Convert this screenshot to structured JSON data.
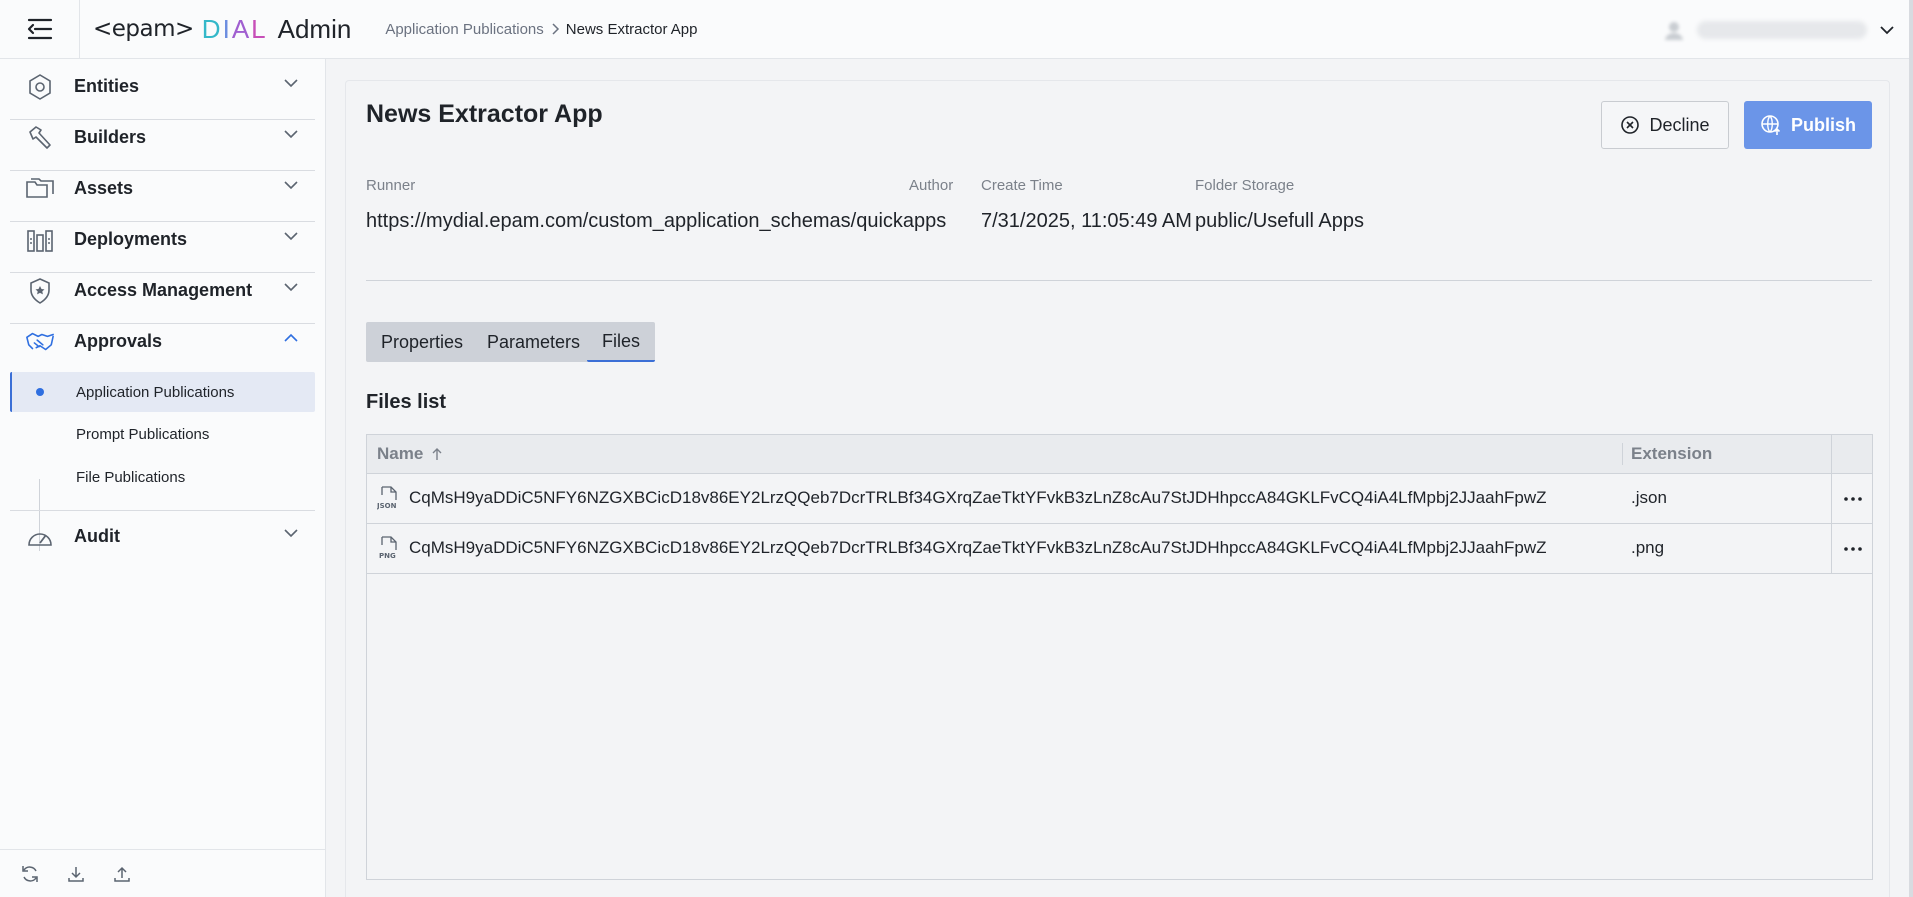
{
  "header": {
    "logo_epam": "<epam>",
    "logo_dial": [
      "D",
      "I",
      "A",
      "L"
    ],
    "logo_admin": "Admin",
    "breadcrumb": [
      "Application Publications",
      "News Extractor App"
    ]
  },
  "sidebar": {
    "items": [
      {
        "label": "Entities",
        "icon": "hexagon-icon"
      },
      {
        "label": "Builders",
        "icon": "hammer-icon"
      },
      {
        "label": "Assets",
        "icon": "folders-icon"
      },
      {
        "label": "Deployments",
        "icon": "deployments-icon"
      },
      {
        "label": "Access Management",
        "icon": "shield-star-icon"
      },
      {
        "label": "Approvals",
        "icon": "handshake-icon"
      },
      {
        "label": "Audit",
        "icon": "gauge-icon"
      }
    ],
    "approvals_sub": [
      "Application Publications",
      "Prompt Publications",
      "File Publications"
    ],
    "footer_icons": [
      "refresh-icon",
      "download-icon",
      "upload-icon"
    ]
  },
  "page": {
    "title": "News Extractor App",
    "decline_label": "Decline",
    "publish_label": "Publish",
    "meta": {
      "runner_label": "Runner",
      "runner_value": "https://mydial.epam.com/custom_application_schemas/quickapps",
      "author_label": "Author",
      "author_value": "",
      "create_time_label": "Create Time",
      "create_time_value": "7/31/2025, 11:05:49 AM",
      "folder_label": "Folder Storage",
      "folder_value": "public/Usefull Apps"
    },
    "tabs": [
      "Properties",
      "Parameters",
      "Files"
    ],
    "active_tab": "Files",
    "files_title": "Files list",
    "table": {
      "col_name": "Name",
      "col_ext": "Extension",
      "rows": [
        {
          "name": "CqMsH9yaDDiC5NFY6NZGXBCicD18v86EY2LrzQQeb7DcrTRLBf34GXrqZaeTktYFvkB3zLnZ8cAu7StJDHhpccA84GKLFvCQ4iA4LfMpbj2JJaahFpwZ",
          "ext": ".json",
          "icon_text": "JSON"
        },
        {
          "name": "CqMsH9yaDDiC5NFY6NZGXBCicD18v86EY2LrzQQeb7DcrTRLBf34GXrqZaeTktYFvkB3zLnZ8cAu7StJDHhpccA84GKLFvCQ4iA4LfMpbj2JJaahFpwZ",
          "ext": ".png",
          "icon_text": "PNG"
        }
      ]
    }
  },
  "colors": {
    "accent": "#3b6fd6",
    "publish_bg": "#6b95e8",
    "sidebar_active_bg": "#e4e9f4"
  }
}
